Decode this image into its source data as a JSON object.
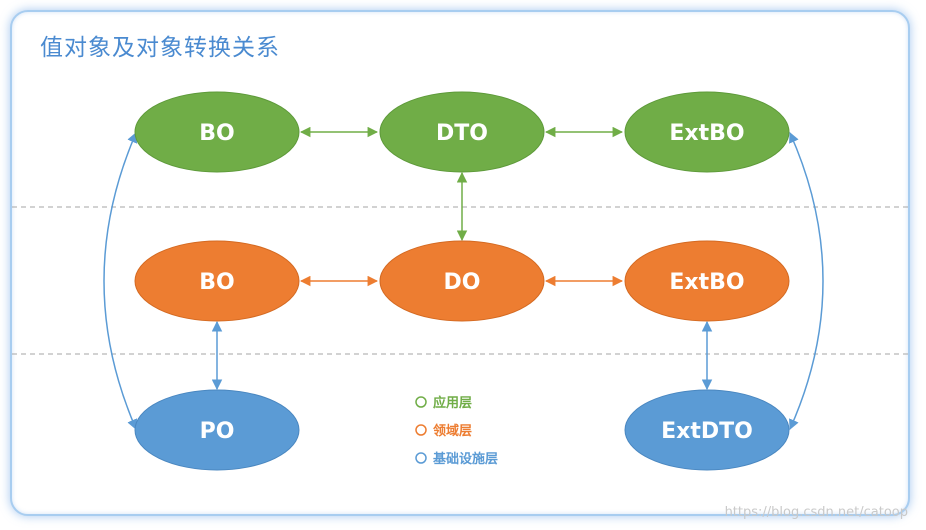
{
  "title": "值对象及对象转换关系",
  "colors": {
    "application": "#70ad47",
    "domain": "#ed7d31",
    "infrastructure": "#5b9bd5",
    "divider": "#a6a6a6"
  },
  "nodes": {
    "app_bo": "BO",
    "app_dto": "DTO",
    "app_extbo": "ExtBO",
    "dom_bo": "BO",
    "dom_do": "DO",
    "dom_extbo": "ExtBO",
    "infra_po": "PO",
    "infra_extdto": "ExtDTO"
  },
  "legend": {
    "application": "应用层",
    "domain": "领域层",
    "infrastructure": "基础设施层"
  },
  "watermark": "https://blog.csdn.net/catoop"
}
